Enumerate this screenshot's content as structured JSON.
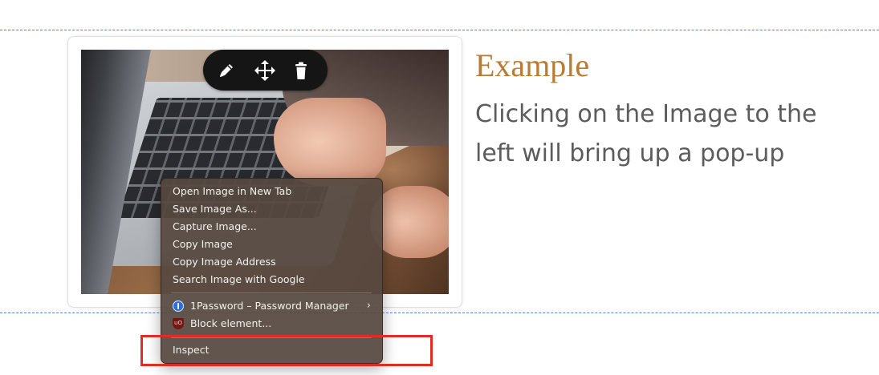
{
  "heading": "Example",
  "body_lines": [
    "Clicking on the Image to the",
    "left will bring up a pop-up"
  ],
  "toolbar": {
    "edit_icon": "pencil-icon",
    "move_icon": "move-arrows-icon",
    "delete_icon": "trash-icon"
  },
  "context_menu": {
    "items": [
      "Open Image in New Tab",
      "Save Image As...",
      "Capture Image...",
      "Copy Image",
      "Copy Image Address",
      "Search Image with Google"
    ],
    "extensions": [
      {
        "label": "1Password – Password Manager",
        "icon": "1password-icon",
        "submenu": true
      },
      {
        "label": "Block element...",
        "icon": "ublock-icon",
        "icon_text": "uO"
      }
    ],
    "inspect": "Inspect"
  },
  "colors": {
    "heading": "#b97a33",
    "body_text": "#5c5c5c",
    "dashed_rule": "#5a82c8",
    "highlight": "#e32b25"
  }
}
